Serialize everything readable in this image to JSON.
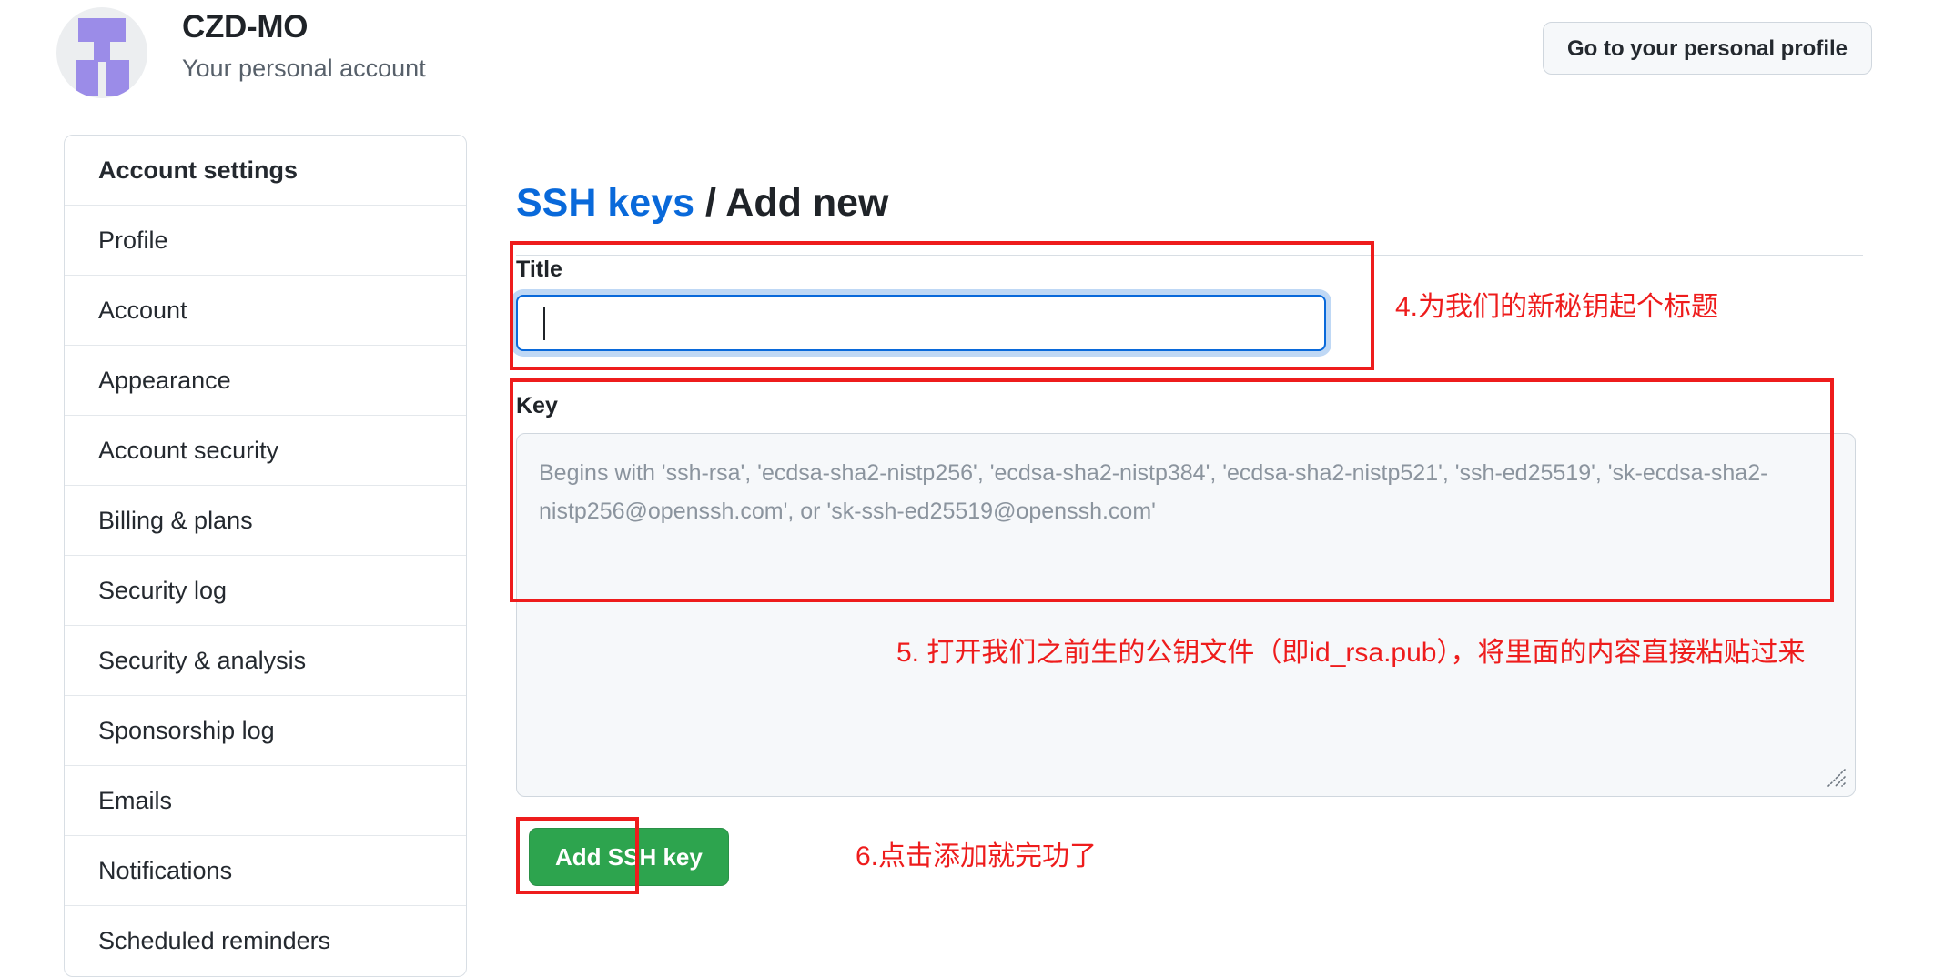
{
  "header": {
    "avatar_icon": "user-identicon-avatar",
    "account_name": "CZD-MO",
    "account_subtitle": "Your personal account",
    "go_to_profile_label": "Go to your personal profile"
  },
  "sidebar": {
    "items": [
      {
        "label": "Account settings",
        "heading": true
      },
      {
        "label": "Profile",
        "heading": false
      },
      {
        "label": "Account",
        "heading": false
      },
      {
        "label": "Appearance",
        "heading": false
      },
      {
        "label": "Account security",
        "heading": false
      },
      {
        "label": "Billing & plans",
        "heading": false
      },
      {
        "label": "Security log",
        "heading": false
      },
      {
        "label": "Security & analysis",
        "heading": false
      },
      {
        "label": "Sponsorship log",
        "heading": false
      },
      {
        "label": "Emails",
        "heading": false
      },
      {
        "label": "Notifications",
        "heading": false
      },
      {
        "label": "Scheduled reminders",
        "heading": false
      }
    ]
  },
  "main": {
    "heading": {
      "link_text": "SSH keys",
      "separator": " / ",
      "current": "Add new"
    },
    "title_field": {
      "label": "Title",
      "value": "",
      "placeholder": ""
    },
    "key_field": {
      "label": "Key",
      "value": "",
      "placeholder": "Begins with 'ssh-rsa', 'ecdsa-sha2-nistp256', 'ecdsa-sha2-nistp384', 'ecdsa-sha2-nistp521', 'ssh-ed25519', 'sk-ecdsa-sha2-nistp256@openssh.com', or 'sk-ssh-ed25519@openssh.com'"
    },
    "submit_label": "Add SSH key"
  },
  "annotations": {
    "step4": "4.为我们的新秘钥起个标题",
    "step5": "5. 打开我们之前生的公钥文件（即id_rsa.pub），将里面的内容直接粘贴过来",
    "step6": "6.点击添加就完功了"
  },
  "colors": {
    "link_blue": "#0969da",
    "focus_border": "#0969da",
    "annotation_red": "#ee1c1c",
    "submit_green": "#2da44e",
    "avatar_purple": "#9b8ce8",
    "avatar_bg": "#eceef0"
  }
}
